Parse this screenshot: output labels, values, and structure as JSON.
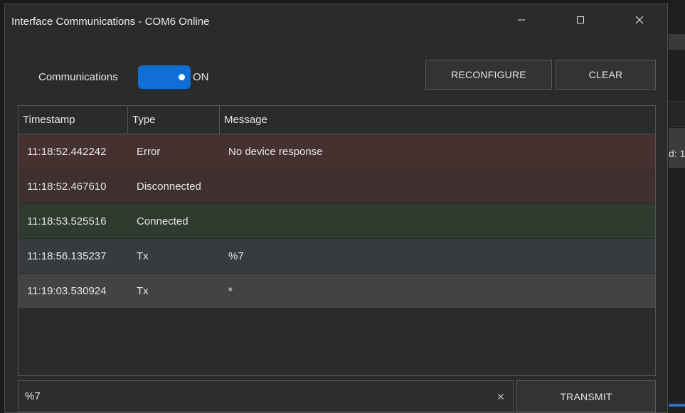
{
  "window": {
    "title": "Interface Communications - COM6 Online"
  },
  "background_app": {
    "partial_text": "d: 1"
  },
  "controls": {
    "communications_label": "Communications",
    "toggle_state": "ON",
    "toggle_on": true,
    "reconfigure_label": "RECONFIGURE",
    "clear_label": "CLEAR"
  },
  "grid": {
    "columns": [
      "Timestamp",
      "Type",
      "Message"
    ],
    "rows": [
      {
        "timestamp": "11:18:52.442242",
        "type": "Error",
        "message": "No device response"
      },
      {
        "timestamp": "11:18:52.467610",
        "type": "Disconnected",
        "message": ""
      },
      {
        "timestamp": "11:18:53.525516",
        "type": "Connected",
        "message": ""
      },
      {
        "timestamp": "11:18:56.135237",
        "type": "Tx",
        "message": "%7"
      },
      {
        "timestamp": "11:19:03.530924",
        "type": "Tx",
        "message": "*"
      }
    ]
  },
  "transmit": {
    "input_value": "%7",
    "button_label": "TRANSMIT"
  },
  "colors": {
    "accent": "#0f6fd6",
    "error_row": "#463131",
    "disconnected_row": "#3f2f2f",
    "connected_row": "#2f3b2e",
    "tx_row": "#373b40"
  },
  "icons": {
    "minimize": "minimize-icon",
    "maximize": "maximize-icon",
    "close": "close-icon",
    "clear_input": "clear-input-icon"
  }
}
